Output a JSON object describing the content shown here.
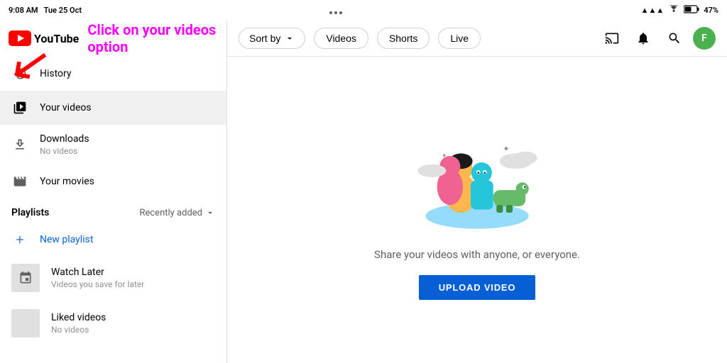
{
  "statusBar": {
    "time": "9:08 AM",
    "date": "Tue 25 Oct",
    "battery": "47%",
    "wifi": true,
    "signal": true
  },
  "annotation": {
    "text": "Click on your videos option",
    "arrow": "↙"
  },
  "sidebar": {
    "logoText": "YouTube",
    "items": [
      {
        "id": "history",
        "label": "History",
        "icon": "history",
        "subtext": ""
      },
      {
        "id": "your-videos",
        "label": "Your videos",
        "icon": "play",
        "subtext": "",
        "active": true
      },
      {
        "id": "downloads",
        "label": "Downloads",
        "icon": "download",
        "subtext": "No videos"
      },
      {
        "id": "your-movies",
        "label": "Your movies",
        "icon": "movies",
        "subtext": ""
      }
    ],
    "playlists": {
      "title": "Playlists",
      "sortLabel": "Recently added",
      "items": [
        {
          "id": "new-playlist",
          "label": "New playlist",
          "icon": "plus",
          "isNew": true
        },
        {
          "id": "watch-later",
          "label": "Watch Later",
          "subtext": "Videos you save for later",
          "icon": "clock"
        },
        {
          "id": "liked-videos",
          "label": "Liked videos",
          "subtext": "No videos",
          "icon": "thumb"
        }
      ]
    }
  },
  "filterBar": {
    "sortBy": "Sort by",
    "chips": [
      "Videos",
      "Shorts",
      "Live"
    ]
  },
  "mainContent": {
    "illustrationAlt": "Share your videos illustration",
    "shareText": "Share your videos with anyone, or everyone.",
    "uploadButton": "UPLOAD VIDEO"
  },
  "headerIcons": {
    "cast": "cast",
    "bell": "bell",
    "search": "search",
    "avatar": "F"
  }
}
